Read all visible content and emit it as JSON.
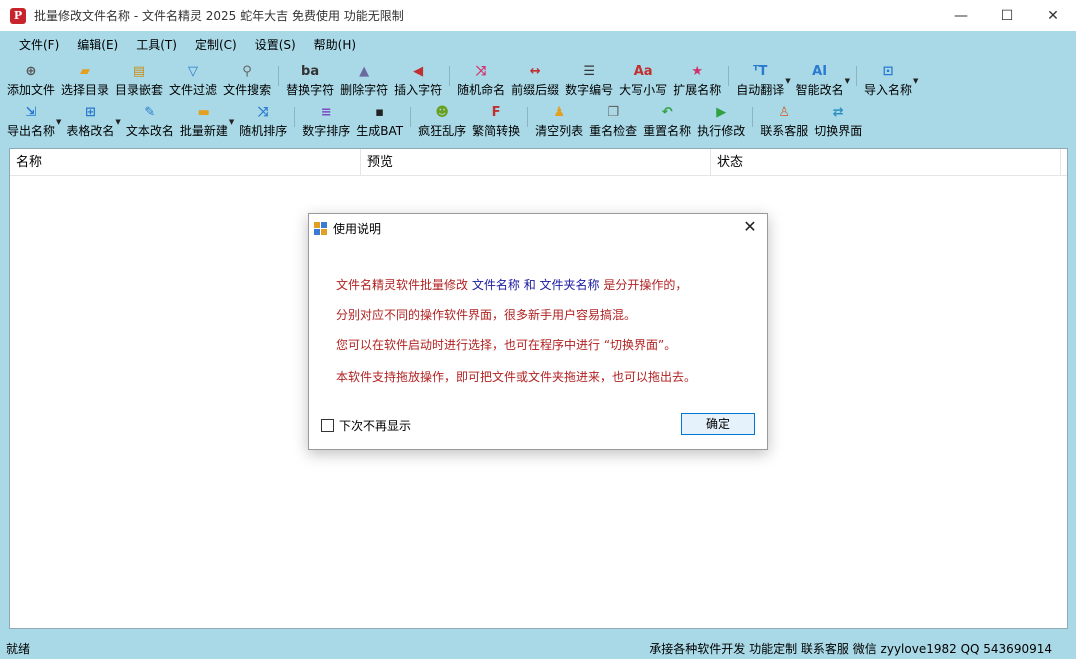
{
  "window": {
    "title": "批量修改文件名称 - 文件名精灵 2025 蛇年大吉 免费使用 功能无限制",
    "app_icon_glyph": "P",
    "minimize_glyph": "—",
    "maximize_glyph": "☐",
    "close_glyph": "✕"
  },
  "menu": [
    "文件(F)",
    "编辑(E)",
    "工具(T)",
    "定制(C)",
    "设置(S)",
    "帮助(H)"
  ],
  "toolbar1": [
    {
      "label": "添加文件",
      "icon": "add-file-icon",
      "glyph": "⊕",
      "color": "#555555"
    },
    {
      "label": "选择目录",
      "icon": "folder-open-icon",
      "glyph": "▰",
      "color": "#e3a020"
    },
    {
      "label": "目录嵌套",
      "icon": "folder-nest-icon",
      "glyph": "▤",
      "color": "#c8901a"
    },
    {
      "label": "文件过滤",
      "icon": "filter-icon",
      "glyph": "▽",
      "color": "#2a7ad0"
    },
    {
      "label": "文件搜索",
      "icon": "search-icon",
      "glyph": "⚲",
      "color": "#666666"
    },
    {
      "label": "替换字符",
      "icon": "replace-text-icon",
      "glyph": "ba",
      "color": "#333333"
    },
    {
      "label": "删除字符",
      "icon": "delete-text-icon",
      "glyph": "▲",
      "color": "#6a6aa0"
    },
    {
      "label": "插入字符",
      "icon": "insert-text-icon",
      "glyph": "◀",
      "color": "#c03030"
    },
    {
      "label": "随机命名",
      "icon": "shuffle-icon",
      "glyph": "⤨",
      "color": "#d0306a"
    },
    {
      "label": "前缀后缀",
      "icon": "prefix-suffix-icon",
      "glyph": "↔",
      "color": "#c03030"
    },
    {
      "label": "数字编号",
      "icon": "numbering-icon",
      "glyph": "☰",
      "color": "#333333"
    },
    {
      "label": "大写小写",
      "icon": "case-icon",
      "glyph": "Aa",
      "color": "#c03030"
    },
    {
      "label": "扩展名称",
      "icon": "extension-star-icon",
      "glyph": "★",
      "color": "#d0306a"
    },
    {
      "label": "自动翻译",
      "icon": "translate-icon",
      "glyph": "ᵀT",
      "color": "#2a7ad0"
    },
    {
      "label": "智能改名",
      "icon": "ai-icon",
      "glyph": "AI",
      "color": "#2a7ad0"
    },
    {
      "label": "导入名称",
      "icon": "import-icon",
      "glyph": "⊡",
      "color": "#2a7ad0"
    }
  ],
  "toolbar2": [
    {
      "label": "导出名称",
      "icon": "export-icon",
      "glyph": "⇲",
      "color": "#2a7ad0"
    },
    {
      "label": "表格改名",
      "icon": "table-icon",
      "glyph": "⊞",
      "color": "#2a7ad0"
    },
    {
      "label": "文本改名",
      "icon": "edit-text-icon",
      "glyph": "✎",
      "color": "#2a7ad0"
    },
    {
      "label": "批量新建",
      "icon": "new-folder-icon",
      "glyph": "▬",
      "color": "#e3a020"
    },
    {
      "label": "随机排序",
      "icon": "random-sort-icon",
      "glyph": "⤨",
      "color": "#2a7ad0"
    },
    {
      "label": "数字排序",
      "icon": "number-sort-icon",
      "glyph": "≡",
      "color": "#7a4ac0"
    },
    {
      "label": "生成BAT",
      "icon": "terminal-icon",
      "glyph": "▪",
      "color": "#222222"
    },
    {
      "label": "疯狂乱序",
      "icon": "crazy-face-icon",
      "glyph": "☻",
      "color": "#6aa020"
    },
    {
      "label": "繁简转换",
      "icon": "font-convert-icon",
      "glyph": "F",
      "color": "#c03030"
    },
    {
      "label": "清空列表",
      "icon": "clear-list-icon",
      "glyph": "♟",
      "color": "#e3a020"
    },
    {
      "label": "重名检查",
      "icon": "duplicate-check-icon",
      "glyph": "❐",
      "color": "#666666"
    },
    {
      "label": "重置名称",
      "icon": "reset-icon",
      "glyph": "↶",
      "color": "#30a040"
    },
    {
      "label": "执行修改",
      "icon": "execute-play-icon",
      "glyph": "▶",
      "color": "#30a040"
    },
    {
      "label": "联系客服",
      "icon": "contact-support-icon",
      "glyph": "♙",
      "color": "#c86a30"
    },
    {
      "label": "切换界面",
      "icon": "switch-ui-icon",
      "glyph": "⇄",
      "color": "#2a90c0"
    }
  ],
  "list": {
    "columns": [
      "名称",
      "预览",
      "状态"
    ]
  },
  "dialog": {
    "title": "使用说明",
    "close_glyph": "✕",
    "line1_a": "文件名精灵软件批量修改",
    "line1_b": "文件名称",
    "line1_c": "和",
    "line1_d": "文件夹名称",
    "line1_e": "是分开操作的，",
    "line2": "分别对应不同的操作软件界面，很多新手用户容易搞混。",
    "line3": "您可以在软件启动时进行选择，也可在程序中进行 “切换界面”。",
    "line4": "本软件支持拖放操作，即可把文件或文件夹拖进来，也可以拖出去。",
    "checkbox_label": "下次不再显示",
    "ok_label": "确定"
  },
  "status": {
    "left": "就绪",
    "right": "承接各种软件开发 功能定制 联系客服 微信 zyylove1982 QQ 543690914"
  }
}
